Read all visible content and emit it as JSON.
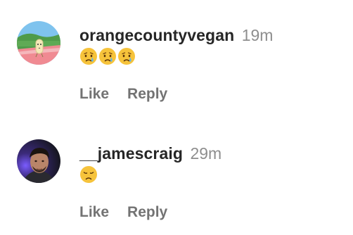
{
  "comments": [
    {
      "username": "orangecountyvegan",
      "time": "19m",
      "avatar_icon": "landscape-illustration-avatar",
      "reactions": [
        "crying-face-icon",
        "crying-face-icon",
        "crying-face-icon"
      ],
      "actions": {
        "like": "Like",
        "reply": "Reply"
      }
    },
    {
      "username": "__jamescraig",
      "time": "29m",
      "avatar_icon": "profile-photo-avatar",
      "reactions": [
        "disappointed-face-icon"
      ],
      "actions": {
        "like": "Like",
        "reply": "Reply"
      }
    }
  ],
  "colors": {
    "username": "#262626",
    "secondary_text": "#8e8e8e",
    "action_text": "#737373",
    "emoji_yellow": "#f6c33b",
    "tear_blue": "#5ab2f0"
  }
}
